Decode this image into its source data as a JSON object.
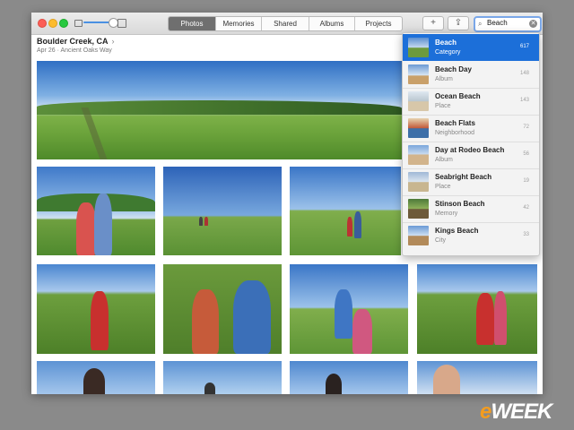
{
  "toolbar": {
    "tabs": [
      "Photos",
      "Memories",
      "Shared",
      "Albums",
      "Projects"
    ],
    "active_tab": "Photos",
    "add_label": "+",
    "share_label": "⇪",
    "search_value": "Beach",
    "search_icon": "⌕",
    "clear_icon": "✕"
  },
  "header": {
    "title": "Boulder Creek, CA",
    "chevron": "›",
    "subtitle": "Apr 26  ·  Ancient Oaks Way"
  },
  "dropdown": {
    "items": [
      {
        "title": "Beach",
        "type": "Category",
        "count": "617"
      },
      {
        "title": "Beach Day",
        "type": "Album",
        "count": "148"
      },
      {
        "title": "Ocean Beach",
        "type": "Place",
        "count": "143"
      },
      {
        "title": "Beach Flats",
        "type": "Neighborhood",
        "count": "72"
      },
      {
        "title": "Day at Rodeo Beach",
        "type": "Album",
        "count": "56"
      },
      {
        "title": "Seabright Beach",
        "type": "Place",
        "count": "19"
      },
      {
        "title": "Stinson Beach",
        "type": "Memory",
        "count": "42"
      },
      {
        "title": "Kings Beach",
        "type": "City",
        "count": "33"
      }
    ]
  },
  "watermark": {
    "prefix": "e",
    "rest": "WEEK"
  },
  "colors": {
    "accent": "#1c6fd9",
    "watermark_orange": "#f39c1f"
  }
}
